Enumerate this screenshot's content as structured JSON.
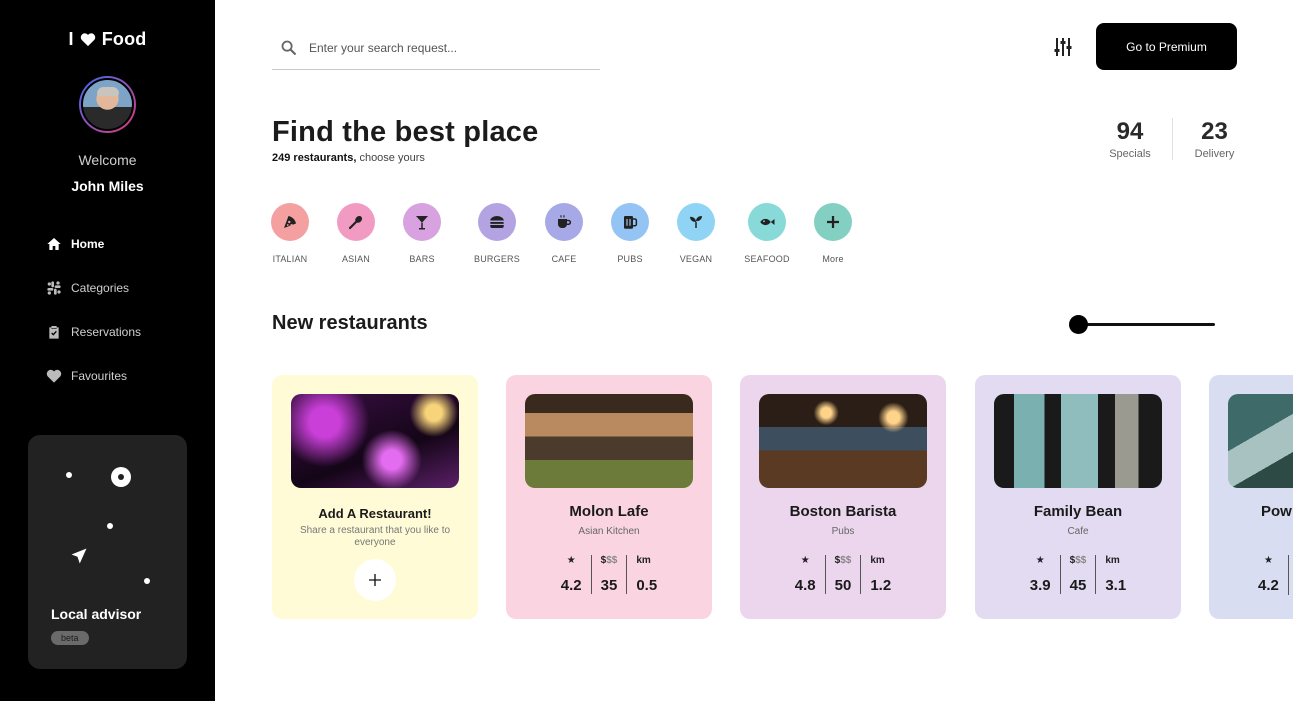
{
  "app": {
    "logo_left": "I",
    "logo_right": "Food"
  },
  "user": {
    "welcome": "Welcome",
    "name": "John Miles"
  },
  "nav": [
    {
      "label": "Home",
      "icon": "home-icon",
      "active": true
    },
    {
      "label": "Categories",
      "icon": "categories-icon",
      "active": false
    },
    {
      "label": "Reservations",
      "icon": "clipboard-icon",
      "active": false
    },
    {
      "label": "Favourites",
      "icon": "heart-icon",
      "active": false
    }
  ],
  "advisor": {
    "label": "Local advisor",
    "badge": "beta"
  },
  "search": {
    "placeholder": "Enter your search request..."
  },
  "premium_label": "Go to Premium",
  "heading": {
    "title": "Find the best place",
    "count": "249 restaurants,",
    "suffix": " choose yours"
  },
  "stats": [
    {
      "value": "94",
      "label": "Specials"
    },
    {
      "value": "23",
      "label": "Delivery"
    }
  ],
  "categories": [
    {
      "label": "ITALIAN",
      "icon": "pizza-icon",
      "color": "#f4a0a0"
    },
    {
      "label": "ASIAN",
      "icon": "spoon-icon",
      "color": "#f29bc2"
    },
    {
      "label": "BARS",
      "icon": "cocktail-icon",
      "color": "#d7a2df"
    },
    {
      "label": "BURGERS",
      "icon": "burger-icon",
      "color": "#b3a3e3"
    },
    {
      "label": "CAFE",
      "icon": "coffee-icon",
      "color": "#a7a9e6"
    },
    {
      "label": "PUBS",
      "icon": "beer-icon",
      "color": "#94c4f3"
    },
    {
      "label": "VEGAN",
      "icon": "leaf-icon",
      "color": "#8fd3f5"
    },
    {
      "label": "SEAFOOD",
      "icon": "fish-icon",
      "color": "#88dad9"
    },
    {
      "label": "More",
      "icon": "plus-icon",
      "color": "#83cfc1"
    }
  ],
  "section_title": "New restaurants",
  "add_card": {
    "title": "Add A Restaurant!",
    "description": "Share a restaurant that you like to everyone",
    "color": "#fffbd6"
  },
  "restaurants": [
    {
      "name": "Molon Lafe",
      "type": "Asian Kitchen",
      "rating": "4.2",
      "price_sym": "$",
      "price_dim": "$$",
      "price": "35",
      "km": "0.5",
      "color": "#fad5e1"
    },
    {
      "name": "Boston Barista",
      "type": "Pubs",
      "rating": "4.8",
      "price_sym": "$",
      "price_dim": "$$",
      "price": "50",
      "km": "1.2",
      "color": "#ecd6ee"
    },
    {
      "name": "Family Bean",
      "type": "Cafe",
      "rating": "3.9",
      "price_sym": "$",
      "price_dim": "$$",
      "price": "45",
      "km": "3.1",
      "color": "#e2dbf1"
    },
    {
      "name": "Pow",
      "type": "",
      "rating": "4.2",
      "price_sym": "",
      "price_dim": "",
      "price": "",
      "km": "",
      "color": "#d9ddf1"
    }
  ],
  "metric_labels": {
    "star": "★",
    "km": "km"
  }
}
